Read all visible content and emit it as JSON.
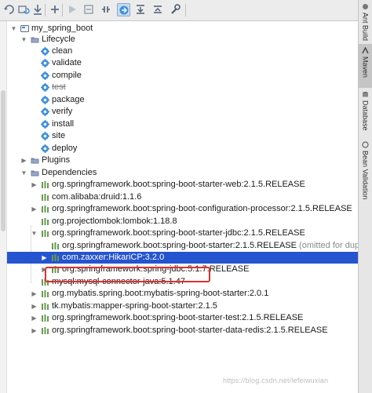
{
  "toolbar": {
    "buttons": [
      {
        "name": "reimport-button",
        "icon": "refresh-icon"
      },
      {
        "name": "generate-sources-button",
        "icon": "reimport-folders-icon"
      },
      {
        "name": "download-sources-button",
        "icon": "download-icon"
      },
      {
        "name": "add-maven-project-button",
        "icon": "plus-icon"
      },
      {
        "name": "run-maven-build-button",
        "icon": "run-icon"
      },
      {
        "name": "execute-goal-button",
        "icon": "maven-goal-icon"
      },
      {
        "name": "toggle-offline-button",
        "icon": "offline-icon"
      },
      {
        "name": "skip-tests-button",
        "icon": "skip-tests-icon",
        "active": true
      },
      {
        "name": "show-dependencies-button",
        "icon": "dependencies-diagram-icon"
      },
      {
        "name": "collapse-all-button",
        "icon": "collapse-all-icon"
      },
      {
        "name": "settings-button",
        "icon": "wrench-icon"
      }
    ]
  },
  "tree": [
    {
      "label": "my_spring_boot",
      "icon": "maven-module-icon",
      "arrow": "down"
    },
    {
      "label": "Lifecycle",
      "icon": "folder-icon",
      "arrow": "down"
    },
    {
      "label": "clean",
      "icon": "gear-icon"
    },
    {
      "label": "validate",
      "icon": "gear-icon"
    },
    {
      "label": "compile",
      "icon": "gear-icon"
    },
    {
      "label": "test",
      "icon": "gear-icon",
      "strike": true
    },
    {
      "label": "package",
      "icon": "gear-icon"
    },
    {
      "label": "verify",
      "icon": "gear-icon"
    },
    {
      "label": "install",
      "icon": "gear-icon"
    },
    {
      "label": "site",
      "icon": "gear-icon"
    },
    {
      "label": "deploy",
      "icon": "gear-icon"
    },
    {
      "label": "Plugins",
      "icon": "folder-icon",
      "arrow": "right"
    },
    {
      "label": "Dependencies",
      "icon": "folder-icon",
      "arrow": "down"
    },
    {
      "label": "org.springframework.boot:spring-boot-starter-web:2.1.5.RELEASE",
      "icon": "library-icon",
      "arrow": "right"
    },
    {
      "label": "com.alibaba:druid:1.1.6",
      "icon": "library-icon"
    },
    {
      "label": "org.springframework.boot:spring-boot-configuration-processor:2.1.5.RELEASE",
      "icon": "library-icon",
      "arrow": "right"
    },
    {
      "label": "org.projectlombok:lombok:1.18.8",
      "icon": "library-icon"
    },
    {
      "label": "org.springframework.boot:spring-boot-starter-jdbc:2.1.5.RELEASE",
      "icon": "library-icon",
      "arrow": "down"
    },
    {
      "label": "org.springframework.boot:spring-boot-starter:2.1.5.RELEASE",
      "icon": "library-icon",
      "omitted": "(omitted for dup"
    },
    {
      "label": "com.zaxxer:HikariCP:3.2.0",
      "icon": "library-icon",
      "arrow": "right",
      "selected": true
    },
    {
      "label": "org.springframework:spring-jdbc:5.1.7.RELEASE",
      "icon": "library-icon",
      "arrow": "right"
    },
    {
      "label": "mysql:mysql-connector-java:5.1.47",
      "icon": "library-icon"
    },
    {
      "label": "org.mybatis.spring.boot:mybatis-spring-boot-starter:2.0.1",
      "icon": "library-icon",
      "arrow": "right"
    },
    {
      "label": "tk.mybatis:mapper-spring-boot-starter:2.1.5",
      "icon": "library-icon",
      "arrow": "right"
    },
    {
      "label": "org.springframework.boot:spring-boot-starter-test:2.1.5.RELEASE",
      "icon": "library-icon",
      "arrow": "right"
    },
    {
      "label": "org.springframework.boot:spring-boot-starter-data-redis:2.1.5.RELEASE",
      "icon": "library-icon",
      "arrow": "right"
    }
  ],
  "side_tabs": [
    {
      "label": "Ant Build",
      "icon": "ant-icon"
    },
    {
      "label": "Maven",
      "icon": "maven-icon",
      "selected": true
    },
    {
      "label": "Database",
      "icon": "database-icon"
    },
    {
      "label": "Bean Validation",
      "icon": "bean-validation-icon"
    }
  ],
  "watermark": "https://blog.csdn.net/lefeiwuxian",
  "colors": {
    "selection": "#2554cf",
    "highlight_box": "#e0302e",
    "gear": "#3c8fdc",
    "folder": "#6f7fa8",
    "library": "#6a9a52"
  }
}
